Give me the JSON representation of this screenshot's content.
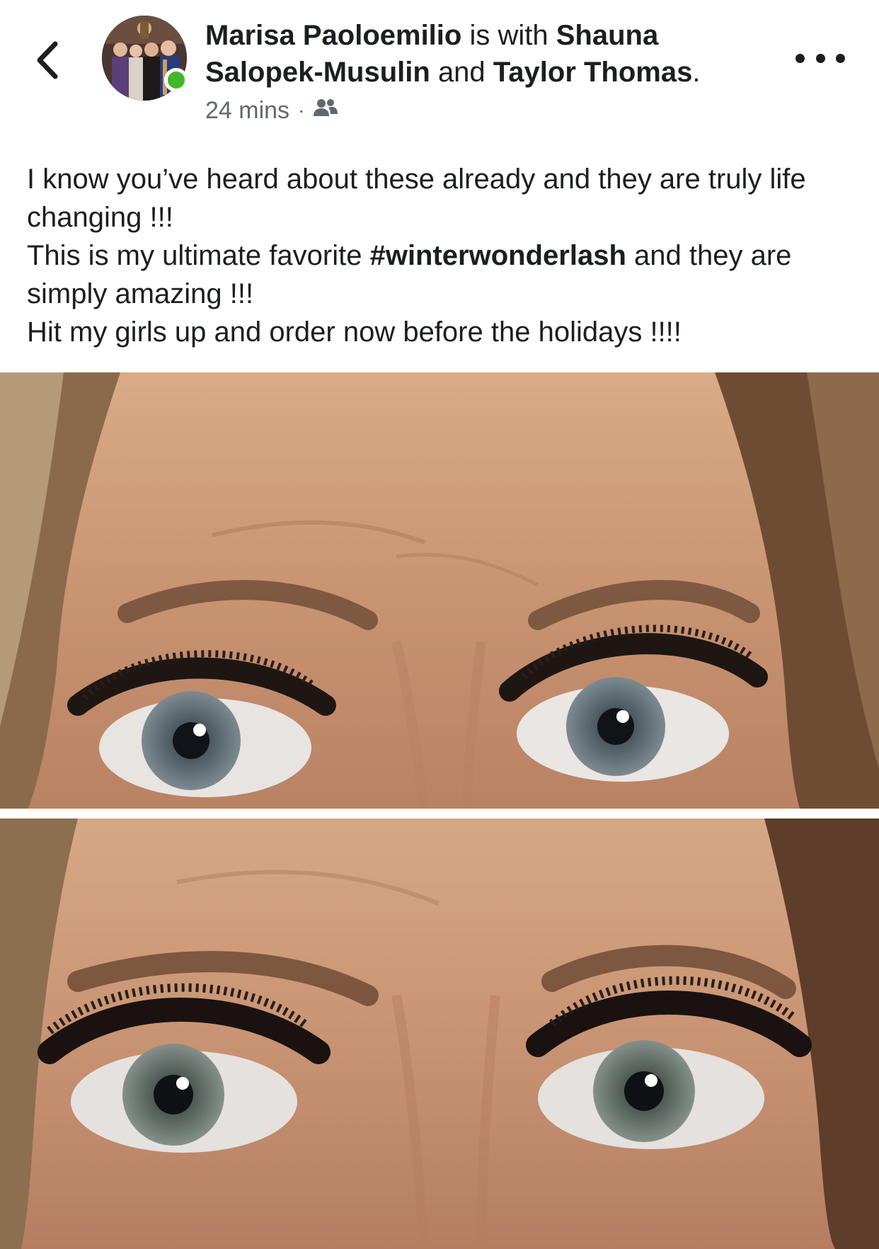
{
  "header": {
    "author": "Marisa Paoloemilio",
    "with_text": "is with",
    "tag_1": "Shauna Salopek-Musulin",
    "and_text": "and",
    "tag_2": "Taylor Thomas",
    "period": ".",
    "time": "24 mins",
    "separator": "·",
    "audience_icon": "friends-icon",
    "back_icon": "chevron-left-icon",
    "more_icon": "more-dots-icon",
    "online_color": "#42b72a"
  },
  "post": {
    "line_1": "I know you’ve heard about these already and they are truly life changing !!!",
    "line_2_before": "This is my ultimate favorite ",
    "hashtag": "#winterwonderlash",
    "line_2_after": " and they are simply amazing !!!",
    "line_3": "Hit my girls up and order now before the holidays !!!!"
  },
  "photos": [
    {
      "name": "eyes-photo-before"
    },
    {
      "name": "eyes-photo-after"
    }
  ]
}
